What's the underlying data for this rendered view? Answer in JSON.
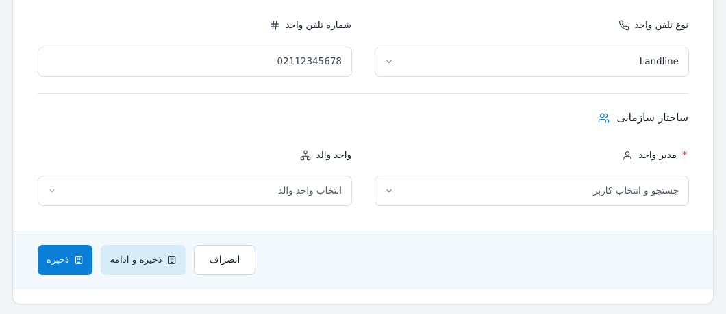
{
  "contact": {
    "phone_type_label": "نوع تلفن واحد",
    "phone_type_value": "Landline",
    "phone_number_label": "شماره تلفن واحد",
    "phone_number_value": "02112345678"
  },
  "org_structure": {
    "title": "ساختار سازمانی",
    "manager_label": "مدیر واحد",
    "manager_required_mark": "*",
    "manager_placeholder": "جستجو و انتخاب کاربر",
    "parent_label": "واحد والد",
    "parent_placeholder": "انتخاب واحد والد"
  },
  "actions": {
    "save": "ذخیره",
    "save_continue": "ذخیره و ادامه",
    "cancel": "انصراف"
  },
  "colors": {
    "primary": "#0b7fd7",
    "soft": "#d6ecf8",
    "required": "#dc2626",
    "section_icon": "#0b7fd7"
  }
}
